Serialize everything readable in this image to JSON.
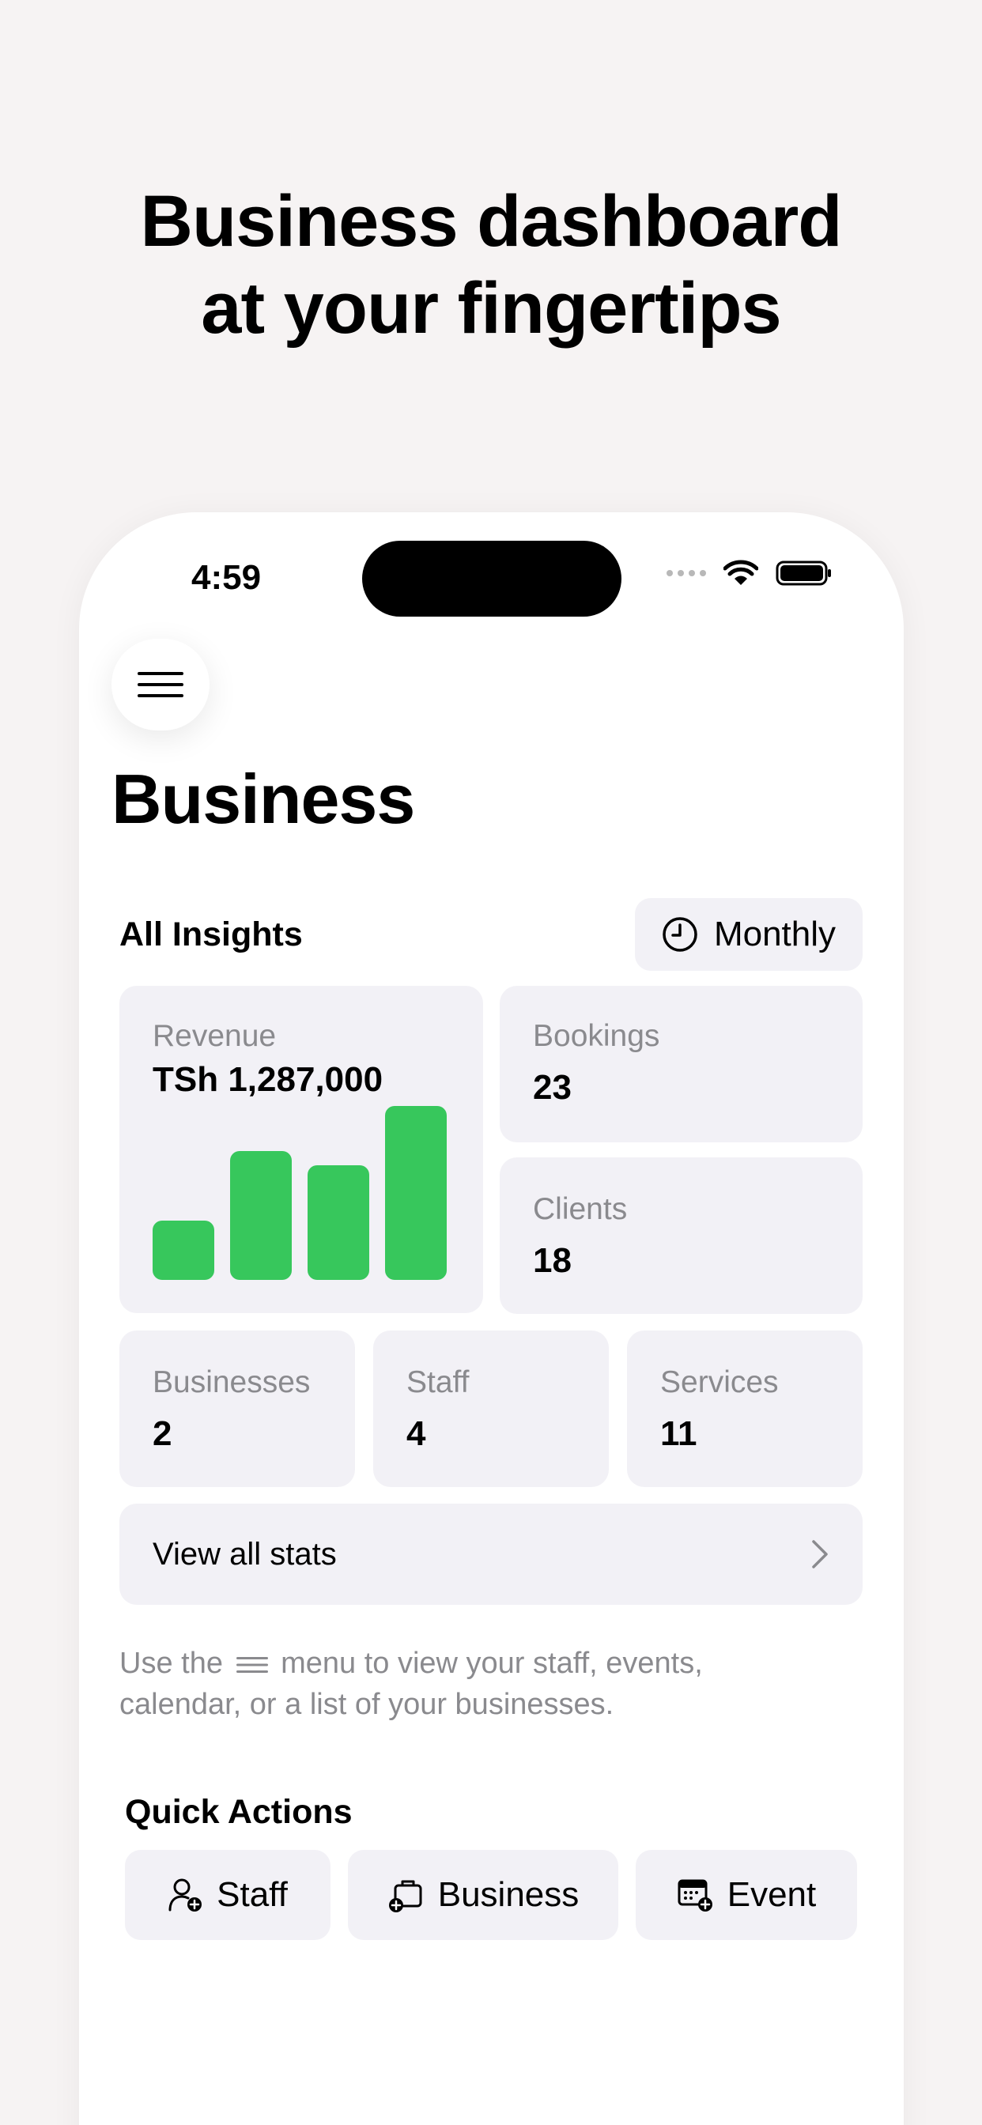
{
  "headline": {
    "line1": "Business dashboard",
    "line2": "at your fingertips"
  },
  "status_bar": {
    "time": "4:59"
  },
  "page": {
    "title": "Business"
  },
  "insights": {
    "label": "All Insights",
    "period_button": "Monthly",
    "revenue": {
      "label": "Revenue",
      "value": "TSh 1,287,000"
    },
    "bookings": {
      "label": "Bookings",
      "value": "23"
    },
    "clients": {
      "label": "Clients",
      "value": "18"
    },
    "businesses": {
      "label": "Businesses",
      "value": "2"
    },
    "staff": {
      "label": "Staff",
      "value": "4"
    },
    "services": {
      "label": "Services",
      "value": "11"
    },
    "view_all": "View all stats"
  },
  "chart_data": {
    "type": "bar",
    "categories": [
      "",
      "",
      "",
      ""
    ],
    "values": [
      0.34,
      0.74,
      0.66,
      1.0
    ],
    "color": "#37c75c"
  },
  "hint": {
    "before": "Use the",
    "after": "menu to view your staff, events, calendar, or a list of your businesses."
  },
  "quick_actions": {
    "label": "Quick Actions",
    "staff": "Staff",
    "business": "Business",
    "event": "Event"
  },
  "colors": {
    "accent_green": "#37c75c",
    "card_bg": "#f2f1f6",
    "muted_text": "#8a8a8e"
  }
}
